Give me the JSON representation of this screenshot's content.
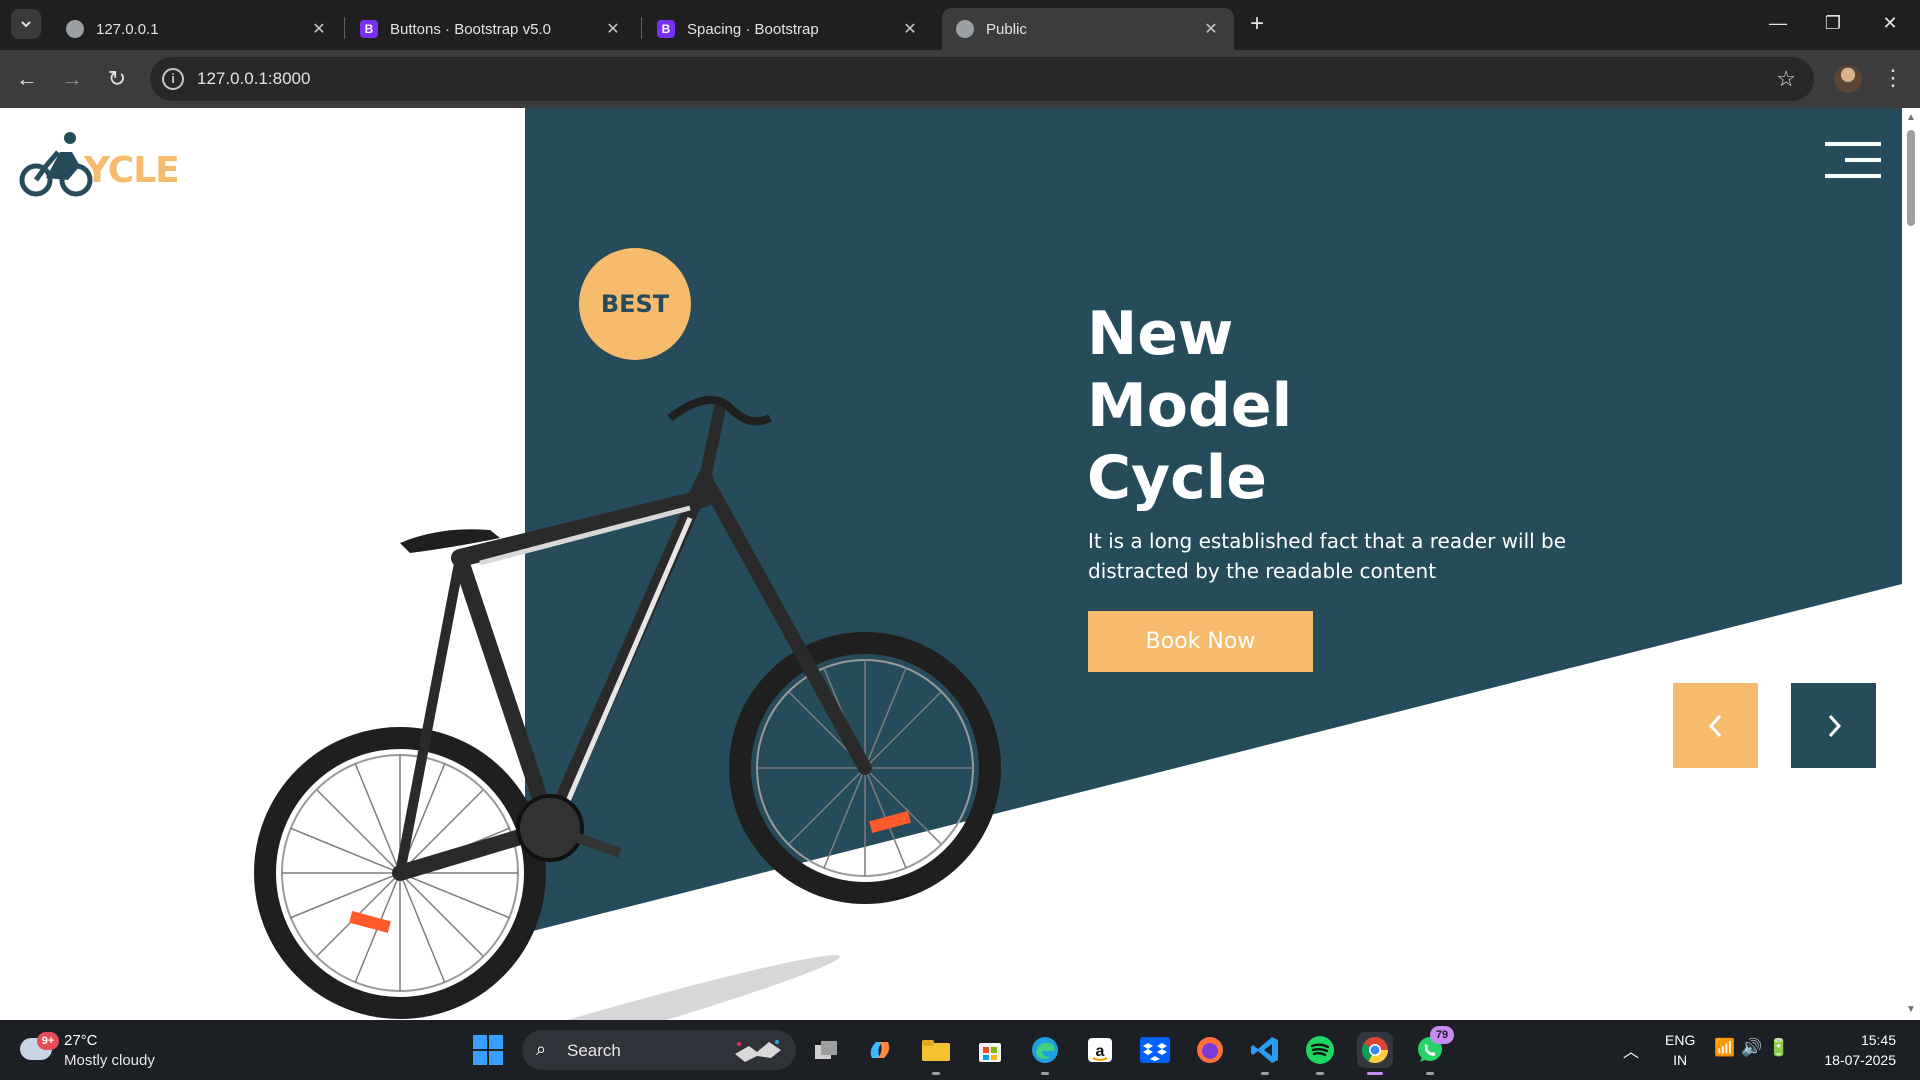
{
  "browser": {
    "tabs": [
      {
        "title": "127.0.0.1",
        "favicon": "globe-icon"
      },
      {
        "title": "Buttons · Bootstrap v5.0",
        "favicon": "bootstrap-icon"
      },
      {
        "title": "Spacing · Bootstrap",
        "favicon": "bootstrap-icon"
      },
      {
        "title": "Public",
        "favicon": "globe-icon"
      }
    ],
    "active_tab_index": 3,
    "url": "127.0.0.1:8000"
  },
  "page": {
    "logo_text": "YCLE",
    "badge": "BEST",
    "headline": [
      "New",
      "Model",
      "Cycle"
    ],
    "description": "It is a long established fact that a reader will be distracted by the readable content",
    "cta_label": "Book Now",
    "colors": {
      "primary_dark": "#264c5c",
      "accent": "#f6bb6d",
      "text_light": "#ffffff"
    }
  },
  "taskbar": {
    "weather": {
      "temp": "27°C",
      "condition": "Mostly cloudy",
      "badge": "9+"
    },
    "search_label": "Search",
    "whatsapp_badge": "79",
    "language": [
      "ENG",
      "IN"
    ],
    "time": "15:45",
    "date": "18-07-2025"
  }
}
